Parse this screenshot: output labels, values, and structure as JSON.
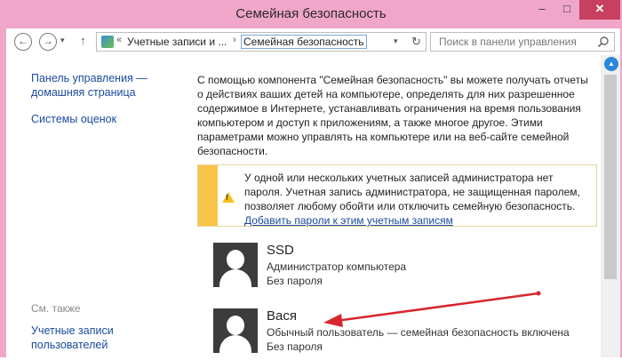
{
  "window": {
    "title": "Семейная безопасность",
    "min_label": "–",
    "max_label": "□",
    "close_label": "✕"
  },
  "nav": {
    "back_glyph": "←",
    "forward_glyph": "→",
    "dropdown_glyph": "▾",
    "up_glyph": "↑",
    "address_seg1": "Учетные записи и ...",
    "address_sep1": "«",
    "address_sep2": "›",
    "address_current": "Семейная безопасность",
    "address_dropdown_glyph": "▾",
    "refresh_glyph": "↻",
    "search_placeholder": "Поиск в панели управления"
  },
  "sidebar": {
    "home_link": "Панель управления — домашняя страница",
    "ratings_link": "Системы оценок",
    "see_also_heading": "См. также",
    "user_accounts_link": "Учетные записи пользователей"
  },
  "main": {
    "intro": "С помощью компонента \"Семейная безопасность\" вы можете получать отчеты о действиях ваших детей на компьютере, определять для них разрешенное содержимое в Интернете, устанавливать ограничения на время пользования компьютером и доступ к приложениям, а также многое другое. Этими параметрами можно управлять на компьютере или на веб-сайте семейной безопасности.",
    "warning_text": "У одной или нескольких учетных записей администратора нет пароля. Учетная запись администратора, не защищенная паролем, позволяет любому обойти или отключить семейную безопасность.",
    "warning_link": "Добавить пароли к этим учетным записям",
    "accounts": [
      {
        "name": "SSD",
        "role": "Администратор компьютера",
        "password": "Без пароля"
      },
      {
        "name": "Вася",
        "role": "Обычный пользователь — семейная безопасность включена",
        "password": "Без пароля"
      }
    ]
  },
  "colors": {
    "frame": "#f0a6c9",
    "close_button": "#c7405f",
    "link": "#1a4a9b",
    "warning_bar": "#f8c54a",
    "annotation_arrow": "#d8262e"
  }
}
